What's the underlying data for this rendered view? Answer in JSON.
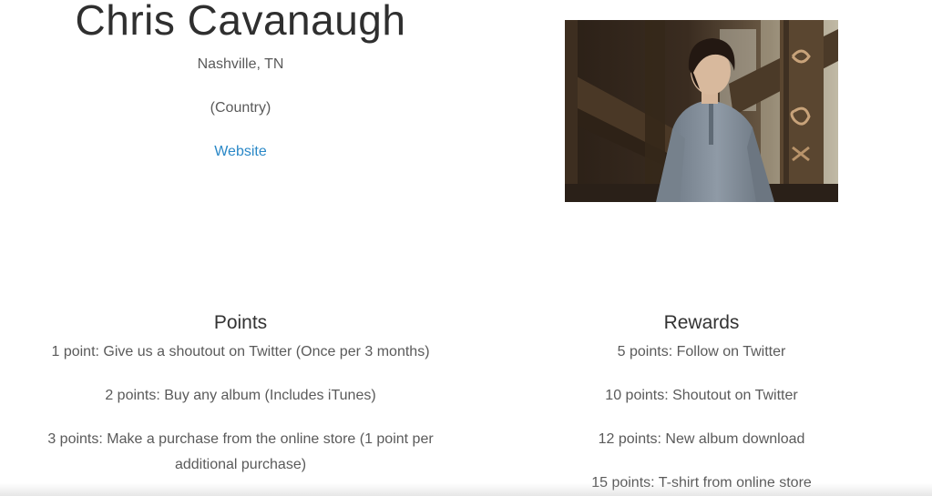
{
  "artist": {
    "name": "Chris Cavanaugh",
    "location": "Nashville, TN",
    "genre": "(Country)",
    "website_label": "Website"
  },
  "photo": {
    "icon": "artist-photo"
  },
  "points": {
    "heading": "Points",
    "items": [
      "1 point: Give us a shoutout on Twitter (Once per 3 months)",
      "2 points: Buy any album (Includes iTunes)",
      "3 points: Make a purchase from the online store (1 point per additional purchase)"
    ]
  },
  "rewards": {
    "heading": "Rewards",
    "items": [
      "5 points: Follow on Twitter",
      "10 points: Shoutout on Twitter",
      "12 points: New album download",
      "15 points: T-shirt from online store"
    ]
  },
  "colors": {
    "link": "#2a88c7",
    "heading": "#333333",
    "text": "#5a5a5a"
  }
}
